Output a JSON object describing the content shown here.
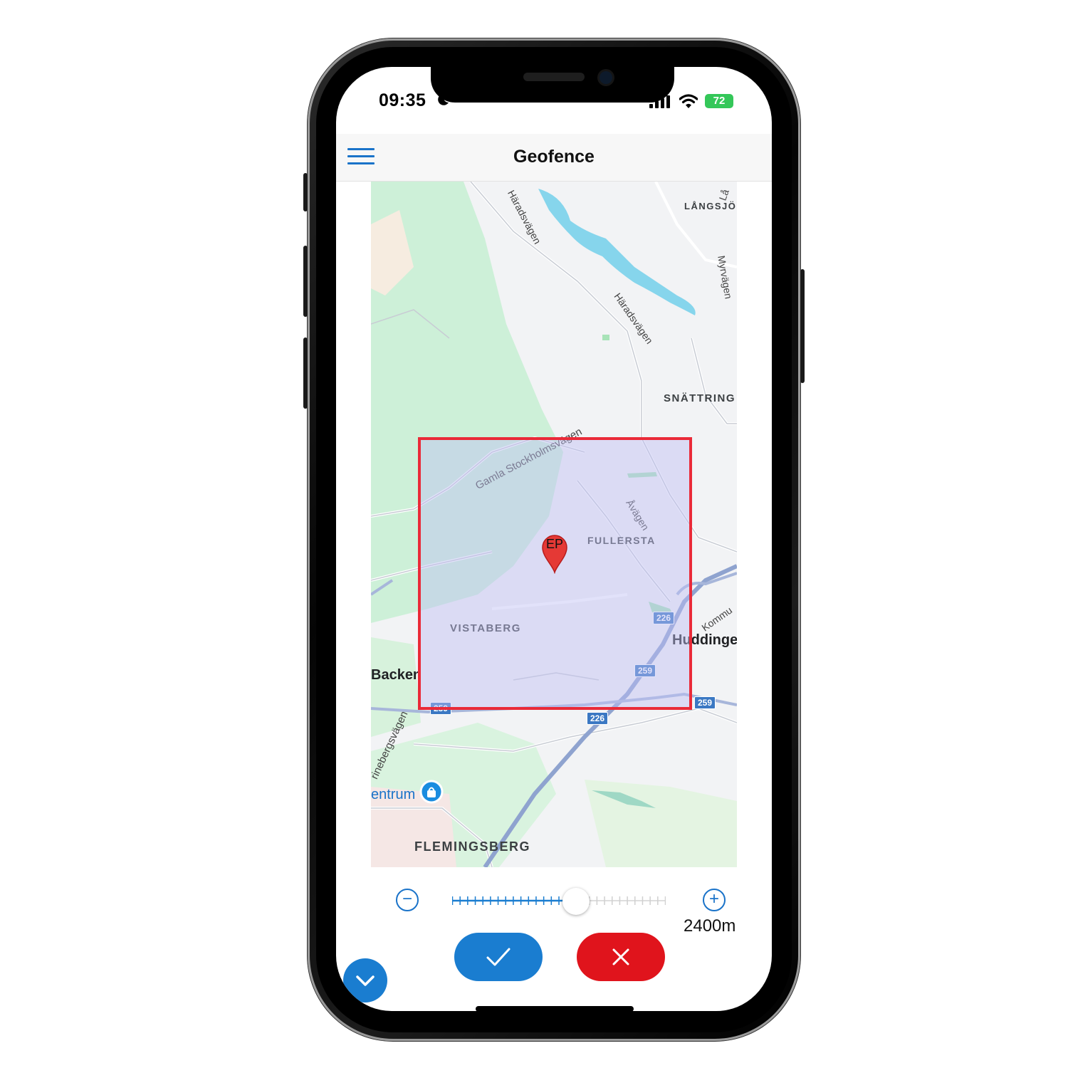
{
  "status_bar": {
    "time": "09:35",
    "battery": "72"
  },
  "header": {
    "title": "Geofence"
  },
  "map": {
    "labels": {
      "langsjo": "LÅNGSJÖ",
      "snattringe": "SNÄTTRING",
      "fullersta": "FULLERSTA",
      "vistaberg": "VISTABERG",
      "flemingsberg": "FLEMINGSBERG"
    },
    "towns": {
      "huddinge": "Huddinge",
      "backen": "Backen",
      "centrum": "entrum"
    },
    "roads": {
      "haradsvagen_top": "Häradsvägen",
      "haradsvagen_mid": "Häradsvägen",
      "myrvagen": "Myrvägen",
      "gamla_stockholmsvagen": "Gamla Stockholmsvägen",
      "avagen": "Åvägen",
      "kommun": "Kommu",
      "trinebergsvagen": "rinebergsvägen",
      "lang": "Lå"
    },
    "shields": {
      "r226a": "226",
      "r259a": "259",
      "r259b": "259",
      "r259c": "259",
      "r226b": "226"
    },
    "marker_label": "EP"
  },
  "slider": {
    "value_fraction": 0.58,
    "tick_count": 28
  },
  "radius_display": "2400m",
  "colors": {
    "accent": "#1a7dd0",
    "danger": "#e0141c",
    "geofence_border": "#ea2a38",
    "marker": "#e53935"
  }
}
